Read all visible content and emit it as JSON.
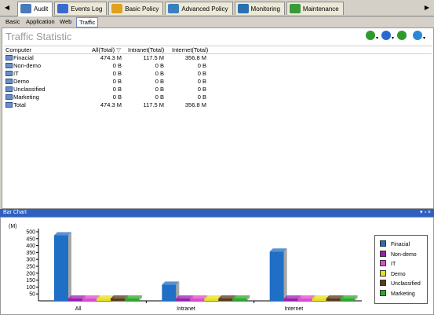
{
  "tabs": [
    {
      "label": "Audit",
      "icon": "audit-icon",
      "color": "#4a7ab8"
    },
    {
      "label": "Events Log",
      "icon": "events-log-icon",
      "color": "#3a6ad0"
    },
    {
      "label": "Basic Policy",
      "icon": "basic-policy-icon",
      "color": "#e0a020"
    },
    {
      "label": "Advanced Policy",
      "icon": "advanced-policy-icon",
      "color": "#3a80c0"
    },
    {
      "label": "Monitoring",
      "icon": "monitoring-icon",
      "color": "#2a70b0"
    },
    {
      "label": "Maintenance",
      "icon": "maintenance-icon",
      "color": "#3a9a3a"
    }
  ],
  "active_tab": 0,
  "subtabs": [
    "Basic",
    "Application",
    "Web",
    "Traffic"
  ],
  "active_subtab": 3,
  "title": "Traffic Statistic",
  "toolbar": [
    {
      "icon": "grid-icon",
      "color": "#2e9a2e"
    },
    {
      "icon": "user-icon",
      "color": "#2a6ad0"
    },
    {
      "icon": "export-icon",
      "color": "#2e9a2e"
    },
    {
      "icon": "home-icon",
      "color": "#2a88d8"
    }
  ],
  "table": {
    "columns": [
      "Computer",
      "All(Total)",
      "Intranet(Total)",
      "Internet(Total)"
    ],
    "rows": [
      {
        "name": "Finacial",
        "all": "474.3 M",
        "intranet": "117.5 M",
        "internet": "356.8 M"
      },
      {
        "name": "Non-demo",
        "all": "0 B",
        "intranet": "0 B",
        "internet": "0 B"
      },
      {
        "name": "IT",
        "all": "0 B",
        "intranet": "0 B",
        "internet": "0 B"
      },
      {
        "name": "Demo",
        "all": "0 B",
        "intranet": "0 B",
        "internet": "0 B"
      },
      {
        "name": "Unclassified",
        "all": "0 B",
        "intranet": "0 B",
        "internet": "0 B"
      },
      {
        "name": "Marketing",
        "all": "0 B",
        "intranet": "0 B",
        "internet": "0 B"
      },
      {
        "name": "Total",
        "all": "474.3 M",
        "intranet": "117.5 M",
        "internet": "356.8 M"
      }
    ]
  },
  "panel": {
    "title": "Bar Chart",
    "buttons": "▾ ▫ ×"
  },
  "chart_data": {
    "type": "bar",
    "ylabel": "(M)",
    "ylim": [
      0,
      500
    ],
    "yticks": [
      50,
      100,
      150,
      200,
      250,
      300,
      350,
      400,
      450,
      500
    ],
    "categories": [
      "All",
      "Intranet",
      "Internet"
    ],
    "series": [
      {
        "name": "Finacial",
        "color": "#1f6fc6",
        "values": [
          474.3,
          117.5,
          356.8
        ]
      },
      {
        "name": "Non-demo",
        "color": "#9a1fb0",
        "values": [
          0,
          0,
          0
        ]
      },
      {
        "name": "IT",
        "color": "#e04ad0",
        "values": [
          0,
          0,
          0
        ]
      },
      {
        "name": "Demo",
        "color": "#e8e020",
        "values": [
          0,
          0,
          0
        ]
      },
      {
        "name": "Unclassified",
        "color": "#5a3a1a",
        "values": [
          0,
          0,
          0
        ]
      },
      {
        "name": "Marketing",
        "color": "#2aa82a",
        "values": [
          0,
          0,
          0
        ]
      }
    ],
    "legend": "right"
  }
}
